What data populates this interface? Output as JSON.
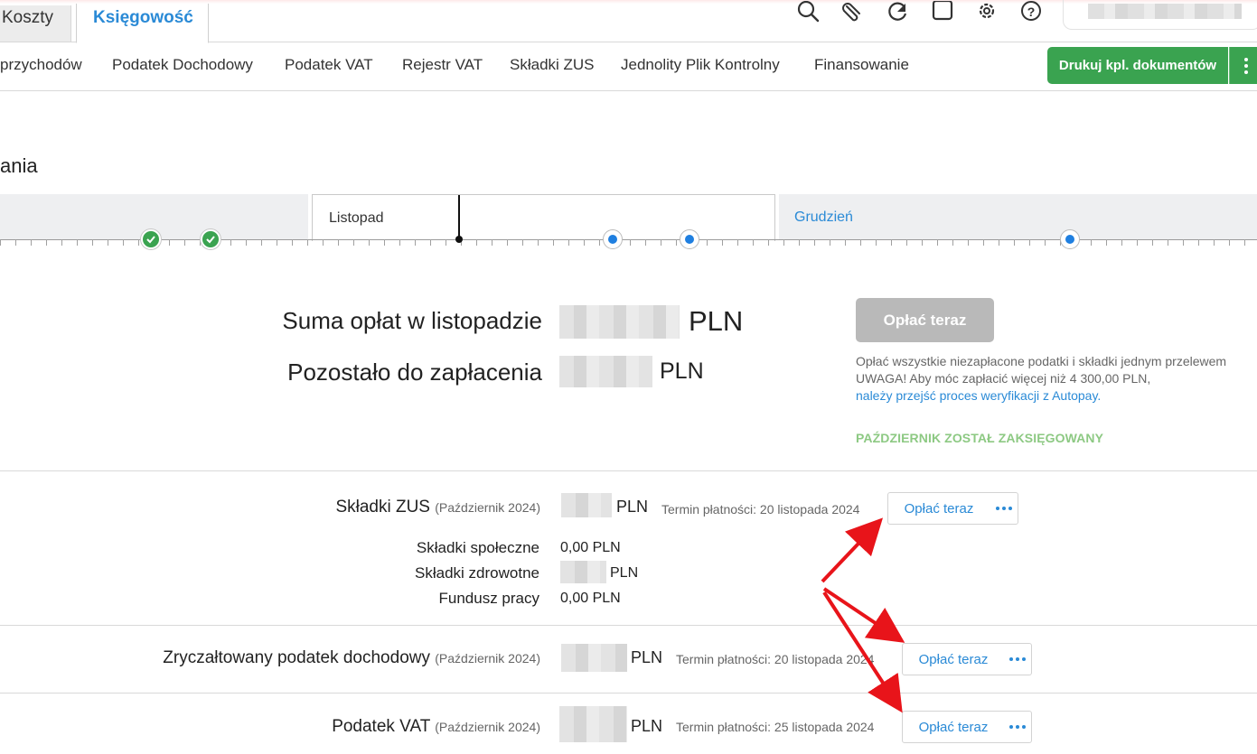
{
  "top_tabs": [
    {
      "label": "Koszty"
    },
    {
      "label": "Księgowość",
      "active": true
    }
  ],
  "top_icons": [
    "search-icon",
    "paperclip-icon",
    "refresh-icon",
    "square-icon",
    "settings-icon",
    "help-icon"
  ],
  "nav": {
    "items": [
      {
        "label": "przychodów"
      },
      {
        "label": "Podatek Dochodowy"
      },
      {
        "label": "Podatek VAT"
      },
      {
        "label": "Rejestr VAT"
      },
      {
        "label": "Składki ZUS"
      },
      {
        "label": "Jednolity Plik Kontrolny"
      },
      {
        "label": "Finansowanie"
      }
    ],
    "print_button": "Drukuj kpl. dokumentów"
  },
  "page": {
    "heading": "ania"
  },
  "timeline": {
    "current_month": "Listopad",
    "next_month": "Grudzień"
  },
  "summary": {
    "total_label": "Suma opłat w listopadzie",
    "total_currency": "PLN",
    "remaining_label": "Pozostało do zapłacenia",
    "remaining_currency": "PLN",
    "pay_all_button": "Opłać teraz",
    "info_line1": "Opłać wszystkie niezapłacone podatki i składki jednym przelewem",
    "info_line2": "UWAGA! Aby móc zapłacić więcej niż 4 300,00 PLN,",
    "info_link": "należy przejść proces weryfikacji z Autopay.",
    "booked_status": "PAŹDZIERNIK ZOSTAŁ ZAKSIĘGOWANY"
  },
  "obligations": [
    {
      "title": "Składki ZUS",
      "period": "(Październik 2024)",
      "currency": "PLN",
      "due": "Termin płatności: 20 listopada 2024",
      "pay_label": "Opłać teraz",
      "details": [
        {
          "label": "Składki społeczne",
          "value": "0,00 PLN"
        },
        {
          "label": "Składki zdrowotne",
          "value": "PLN"
        },
        {
          "label": "Fundusz pracy",
          "value": "0,00 PLN"
        }
      ]
    },
    {
      "title": "Zryczałtowany podatek dochodowy",
      "period": "(Październik 2024)",
      "currency": "PLN",
      "due": "Termin płatności: 20 listopada 2024",
      "pay_label": "Opłać teraz"
    },
    {
      "title": "Podatek VAT",
      "period": "(Październik 2024)",
      "currency": "PLN",
      "due": "Termin płatności: 25 listopada 2024",
      "pay_label": "Opłać teraz"
    }
  ],
  "colors": {
    "accent_blue": "#2a8ad6",
    "brand_green": "#3aa350",
    "annotation_red": "#e8141a",
    "booked_green": "#8dc983"
  }
}
